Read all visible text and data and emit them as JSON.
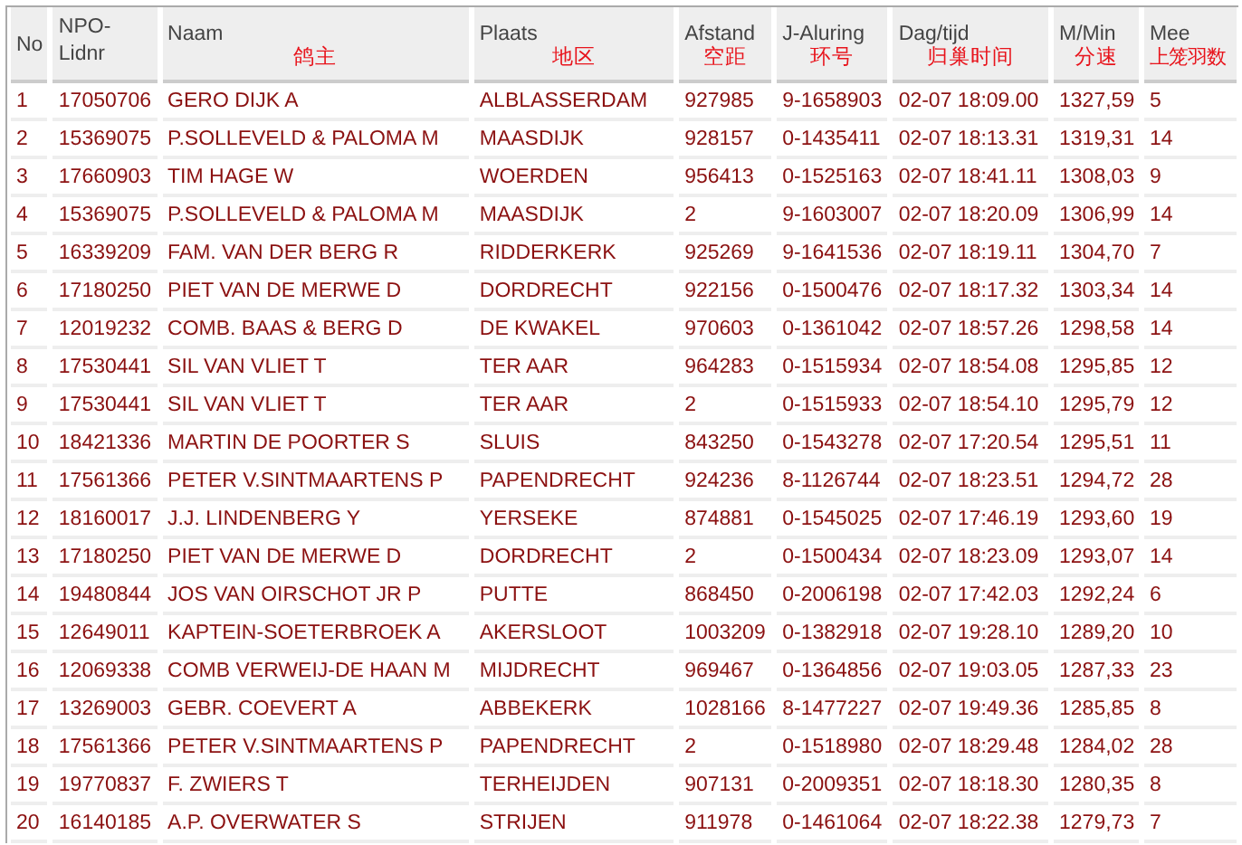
{
  "table": {
    "columns": [
      {
        "label": "No"
      },
      {
        "label": "NPO-Lidnr"
      },
      {
        "label": "Naam",
        "label_zh": "鸽主"
      },
      {
        "label": "Plaats",
        "label_zh": "地区"
      },
      {
        "label": "Afstand",
        "label_zh": "空距"
      },
      {
        "label": "J-Aluring",
        "label_zh": "环号"
      },
      {
        "label": "Dag/tijd",
        "label_zh": "归巢时间"
      },
      {
        "label": "M/Min",
        "label_zh": "分速"
      },
      {
        "label": "Mee",
        "label_zh": "上笼羽数"
      }
    ],
    "rows": [
      [
        "1",
        "17050706",
        "GERO DIJK A",
        "ALBLASSERDAM",
        "927985",
        "9-1658903",
        "02-07 18:09.00",
        "1327,59",
        "5"
      ],
      [
        "2",
        "15369075",
        "P.SOLLEVELD & PALOMA M",
        "MAASDIJK",
        "928157",
        "0-1435411",
        "02-07 18:13.31",
        "1319,31",
        "14"
      ],
      [
        "3",
        "17660903",
        "TIM HAGE W",
        "WOERDEN",
        "956413",
        "0-1525163",
        "02-07 18:41.11",
        "1308,03",
        "9"
      ],
      [
        "4",
        "15369075",
        "P.SOLLEVELD & PALOMA M",
        "MAASDIJK",
        "2",
        "9-1603007",
        "02-07 18:20.09",
        "1306,99",
        "14"
      ],
      [
        "5",
        "16339209",
        "FAM. VAN DER BERG R",
        "RIDDERKERK",
        "925269",
        "9-1641536",
        "02-07 18:19.11",
        "1304,70",
        "7"
      ],
      [
        "6",
        "17180250",
        "PIET VAN DE MERWE D",
        "DORDRECHT",
        "922156",
        "0-1500476",
        "02-07 18:17.32",
        "1303,34",
        "14"
      ],
      [
        "7",
        "12019232",
        "COMB. BAAS & BERG D",
        "DE KWAKEL",
        "970603",
        "0-1361042",
        "02-07 18:57.26",
        "1298,58",
        "14"
      ],
      [
        "8",
        "17530441",
        "SIL VAN VLIET T",
        "TER AAR",
        "964283",
        "0-1515934",
        "02-07 18:54.08",
        "1295,85",
        "12"
      ],
      [
        "9",
        "17530441",
        "SIL VAN VLIET T",
        "TER AAR",
        "2",
        "0-1515933",
        "02-07 18:54.10",
        "1295,79",
        "12"
      ],
      [
        "10",
        "18421336",
        "MARTIN DE POORTER S",
        "SLUIS",
        "843250",
        "0-1543278",
        "02-07 17:20.54",
        "1295,51",
        "11"
      ],
      [
        "11",
        "17561366",
        "PETER V.SINTMAARTENS P",
        "PAPENDRECHT",
        "924236",
        "8-1126744",
        "02-07 18:23.51",
        "1294,72",
        "28"
      ],
      [
        "12",
        "18160017",
        "J.J. LINDENBERG Y",
        "YERSEKE",
        "874881",
        "0-1545025",
        "02-07 17:46.19",
        "1293,60",
        "19"
      ],
      [
        "13",
        "17180250",
        "PIET VAN DE MERWE D",
        "DORDRECHT",
        "2",
        "0-1500434",
        "02-07 18:23.09",
        "1293,07",
        "14"
      ],
      [
        "14",
        "19480844",
        "JOS VAN OIRSCHOT JR P",
        "PUTTE",
        "868450",
        "0-2006198",
        "02-07 17:42.03",
        "1292,24",
        "6"
      ],
      [
        "15",
        "12649011",
        "KAPTEIN-SOETERBROEK A",
        "AKERSLOOT",
        "1003209",
        "0-1382918",
        "02-07 19:28.10",
        "1289,20",
        "10"
      ],
      [
        "16",
        "12069338",
        "COMB VERWEIJ-DE HAAN M",
        "MIJDRECHT",
        "969467",
        "0-1364856",
        "02-07 19:03.05",
        "1287,33",
        "23"
      ],
      [
        "17",
        "13269003",
        "GEBR. COEVERT A",
        "ABBEKERK",
        "1028166",
        "8-1477227",
        "02-07 19:49.36",
        "1285,85",
        "8"
      ],
      [
        "18",
        "17561366",
        "PETER V.SINTMAARTENS P",
        "PAPENDRECHT",
        "2",
        "0-1518980",
        "02-07 18:29.48",
        "1284,02",
        "28"
      ],
      [
        "19",
        "19770837",
        "F. ZWIERS T",
        "TERHEIJDEN",
        "907131",
        "0-2009351",
        "02-07 18:18.30",
        "1280,35",
        "8"
      ],
      [
        "20",
        "16140185",
        "A.P. OVERWATER S",
        "STRIJEN",
        "911978",
        "0-1461064",
        "02-07 18:22.38",
        "1279,73",
        "7"
      ]
    ]
  }
}
